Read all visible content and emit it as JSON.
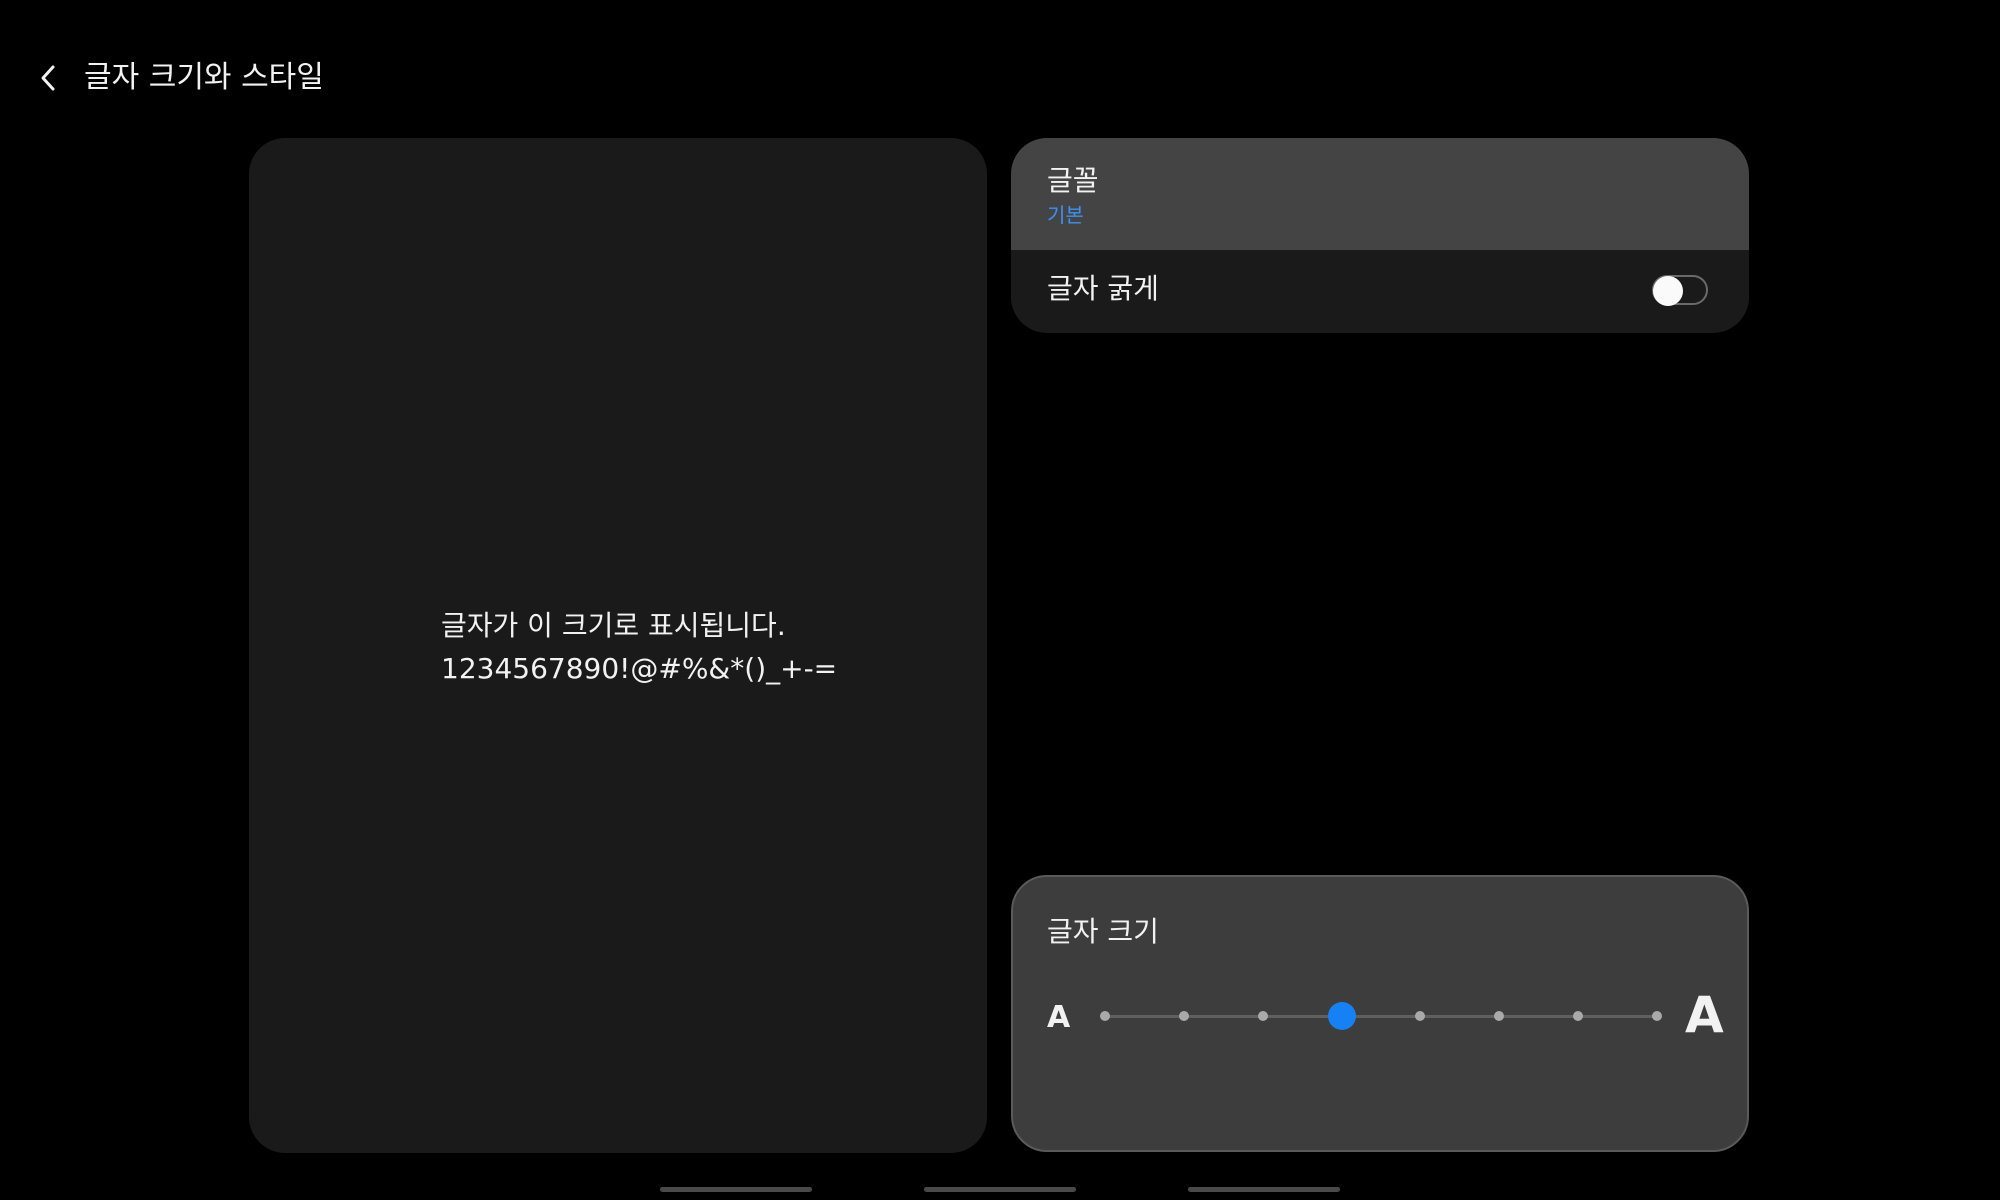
{
  "header": {
    "title": "글자 크기와 스타일",
    "back_icon": "chevron-left-icon"
  },
  "preview": {
    "line1": "글자가 이 크기로 표시됩니다.",
    "line2": "1234567890!@#%&*()_+-="
  },
  "settings": {
    "font": {
      "label": "글꼴",
      "value": "기본"
    },
    "bold": {
      "label": "글자 굵게",
      "enabled": false
    }
  },
  "font_size": {
    "label": "글자 크기",
    "small_label": "A",
    "large_label": "A",
    "steps": 8,
    "selected_step": 4
  },
  "colors": {
    "accent": "#1581f5",
    "link": "#3e91f2",
    "background": "#000000",
    "card": "#1a1a1a",
    "highlight_row": "#444444"
  }
}
